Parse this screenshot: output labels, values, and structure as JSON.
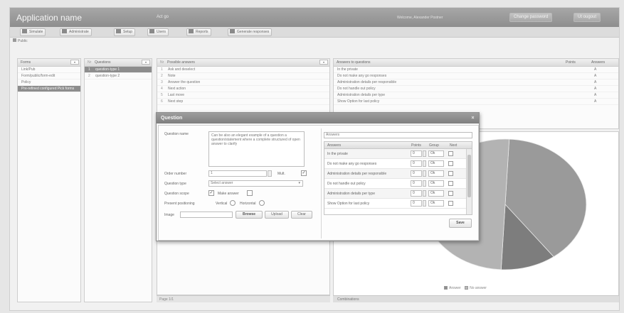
{
  "header": {
    "app_title": "Application name",
    "subtitle": "Act go",
    "user_info": "Welcome, Alexander Postner",
    "btn_change_password": "Change password",
    "btn_logout": "Ut ougout"
  },
  "toolbar": {
    "buttons": [
      "Simulate",
      "Administrate",
      "Setup",
      "Users",
      "Reports",
      "Generate responses"
    ],
    "subtab": "Public"
  },
  "panels": {
    "forms": {
      "header": "Forms",
      "items": [
        "Link/Pub",
        "Form/public/form-edit",
        "Policy",
        "Pre-refined configured Pick forms"
      ],
      "selected": 3
    },
    "questions": {
      "header_num": "Nr",
      "header": "Questions",
      "items": [
        {
          "num": "1",
          "label": "question-type 1"
        },
        {
          "num": "2",
          "label": "question-type 2"
        }
      ],
      "selected": 0
    },
    "possible_answers": {
      "header_num": "Nr",
      "header": "Possible answers",
      "items": [
        {
          "num": "1",
          "label": "Ask and deselect"
        },
        {
          "num": "2",
          "label": "Note"
        },
        {
          "num": "3",
          "label": "Answer the question"
        },
        {
          "num": "4",
          "label": "Next action"
        },
        {
          "num": "5",
          "label": "Last move"
        },
        {
          "num": "6",
          "label": "Next step"
        }
      ]
    },
    "responses": {
      "header": "Answers to questions",
      "col_points": "Points",
      "col_answer": "Answers",
      "items": [
        {
          "label": "In the private",
          "answer": "A"
        },
        {
          "label": "Do not make any go responses",
          "answer": "A"
        },
        {
          "label": "Administration details per responsible",
          "answer": "A"
        },
        {
          "label": "Do not handle out policy",
          "answer": "A"
        },
        {
          "label": "Administration details per type",
          "answer": "A"
        },
        {
          "label": "Show Option for last policy",
          "answer": "A"
        }
      ]
    },
    "status_text": "Page 1/1",
    "chart_footer": "Combinations"
  },
  "chart_data": {
    "type": "pie",
    "title": "",
    "legend": [
      {
        "name": "Answer",
        "color": "#8f8f8f"
      },
      {
        "name": "No answer",
        "color": "#b9b9b9"
      }
    ],
    "slices": [
      {
        "label": "",
        "value": 39,
        "color": "#9a9a9a"
      },
      {
        "label": "",
        "value": 11,
        "color": "#7d7d7d"
      },
      {
        "label": "",
        "value": 50,
        "color": "#b3b3b3"
      }
    ],
    "legend_position": "bottom"
  },
  "dialog": {
    "title": "Question",
    "labels": {
      "question_name": "Question name",
      "order_number": "Order number",
      "question_type": "Question type",
      "question_scope": "Question scope",
      "present_positioning": "Present positioning",
      "image": "Image"
    },
    "question_text": "Can be also an elegant example of a question a question/statement where a complete structured of open answer to clarify",
    "order_number_value": "1",
    "order_suffix": "Mult.",
    "question_type_value": "Select answer",
    "scope_label": "Make answer",
    "vertical": "Vertical",
    "horizontal": "Horizontal",
    "btn_browse": "Browse",
    "btn_upload": "Upload",
    "btn_clear": "Clear",
    "answers_search": "Answers",
    "answers_cols": {
      "answer": "Answers",
      "points": "Points",
      "group": "Group",
      "next": "Next"
    },
    "answers": [
      {
        "label": "In the private",
        "points": "0",
        "group": "Ok"
      },
      {
        "label": "Do not make any go responses",
        "points": "0",
        "group": "Ok"
      },
      {
        "label": "Administration details per responsible",
        "points": "0",
        "group": "Ok"
      },
      {
        "label": "Do not handle out policy",
        "points": "0",
        "group": "Ok"
      },
      {
        "label": "Administration details per type",
        "points": "0",
        "group": "Ok"
      },
      {
        "label": "Show Option for last policy",
        "points": "0",
        "group": "Ok"
      }
    ],
    "btn_save": "Save"
  }
}
